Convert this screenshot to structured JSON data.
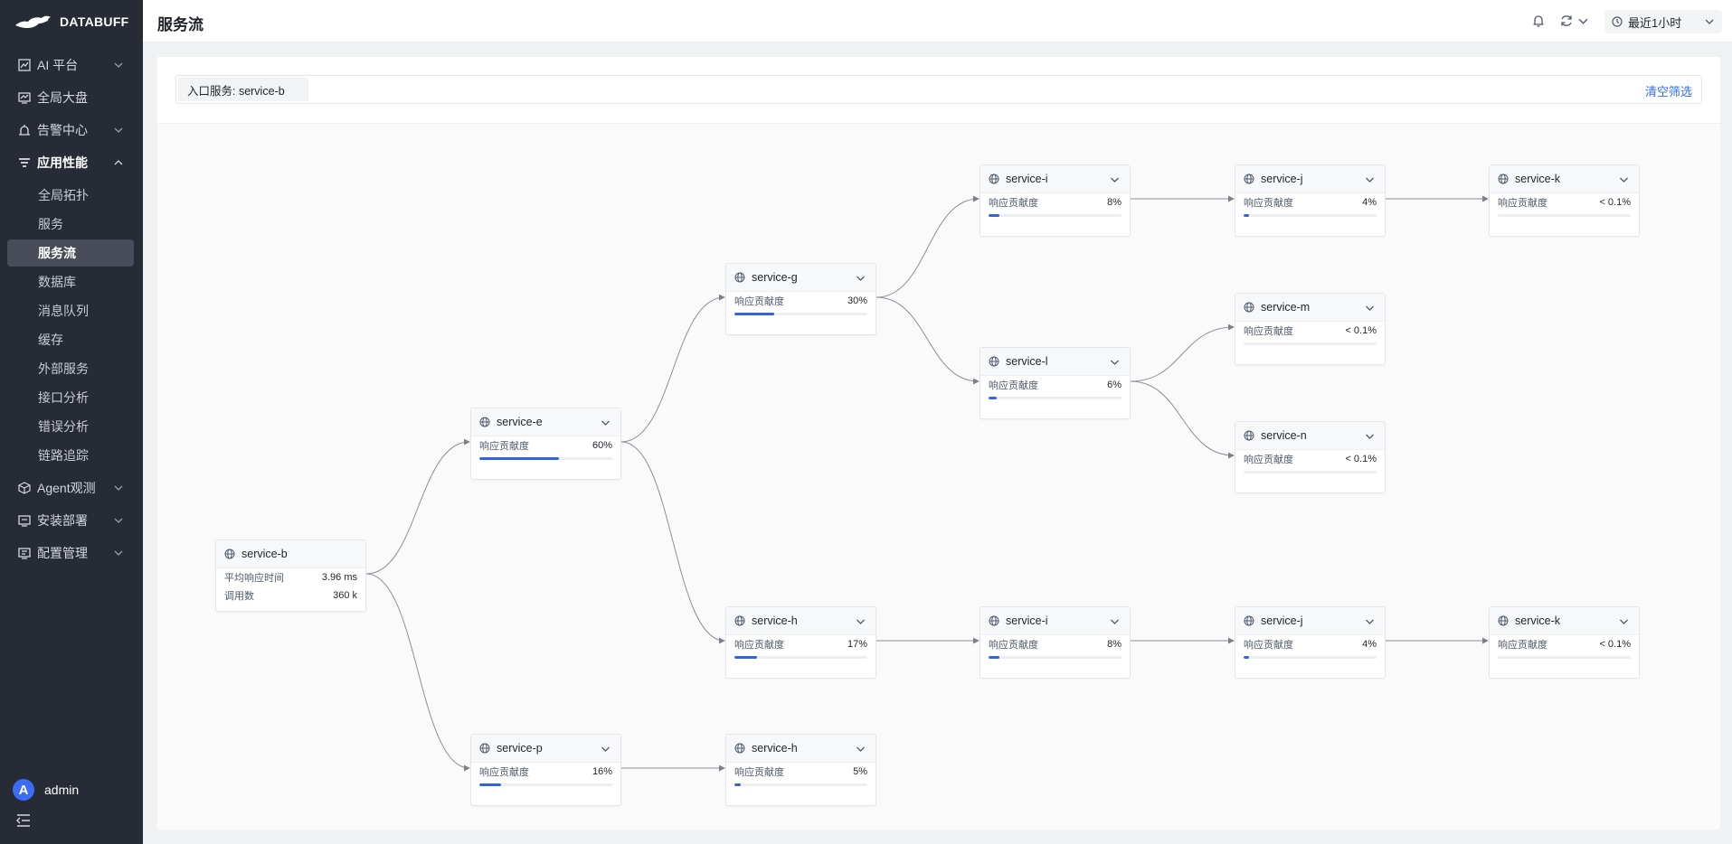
{
  "brand": {
    "name": "DATABUFF"
  },
  "nav": {
    "groups": [
      {
        "label": "AI 平台",
        "icon": "chart-icon"
      },
      {
        "label": "全局大盘",
        "icon": "dashboard-icon"
      },
      {
        "label": "告警中心",
        "icon": "alarm-icon"
      },
      {
        "label": "应用性能",
        "icon": "filter-icon",
        "open": true
      },
      {
        "label": "Agent观测",
        "icon": "cube-icon"
      },
      {
        "label": "安装部署",
        "icon": "deploy-icon"
      },
      {
        "label": "配置管理",
        "icon": "config-icon"
      }
    ],
    "sub_items": [
      "全局拓扑",
      "服务",
      "服务流",
      "数据库",
      "消息队列",
      "缓存",
      "外部服务",
      "接口分析",
      "错误分析",
      "链路追踪"
    ],
    "active_sub": "服务流"
  },
  "user": {
    "initial": "A",
    "name": "admin"
  },
  "header": {
    "title": "服务流",
    "time_range": "最近1小时"
  },
  "filter": {
    "tag": "入口服务: service-b",
    "clear_label": "清空筛选"
  },
  "metric_label": "响应贡献度",
  "root": {
    "name": "service-b",
    "metrics": [
      {
        "label": "平均响应时间",
        "value": "3.96 ms"
      },
      {
        "label": "调用数",
        "value": "360 k"
      }
    ]
  },
  "nodes": [
    {
      "id": "e",
      "name": "service-e",
      "value": "60%",
      "fraction": 0.6
    },
    {
      "id": "p",
      "name": "service-p",
      "value": "16%",
      "fraction": 0.16
    },
    {
      "id": "g",
      "name": "service-g",
      "value": "30%",
      "fraction": 0.3
    },
    {
      "id": "h1",
      "name": "service-h",
      "value": "17%",
      "fraction": 0.17
    },
    {
      "id": "h2",
      "name": "service-h",
      "value": "5%",
      "fraction": 0.05
    },
    {
      "id": "i1",
      "name": "service-i",
      "value": "8%",
      "fraction": 0.08
    },
    {
      "id": "l",
      "name": "service-l",
      "value": "6%",
      "fraction": 0.06
    },
    {
      "id": "i2",
      "name": "service-i",
      "value": "8%",
      "fraction": 0.08
    },
    {
      "id": "j1",
      "name": "service-j",
      "value": "4%",
      "fraction": 0.04
    },
    {
      "id": "m",
      "name": "service-m",
      "value": "< 0.1%",
      "fraction": 0
    },
    {
      "id": "n",
      "name": "service-n",
      "value": "< 0.1%",
      "fraction": 0
    },
    {
      "id": "j2",
      "name": "service-j",
      "value": "4%",
      "fraction": 0.04
    },
    {
      "id": "k1",
      "name": "service-k",
      "value": "< 0.1%",
      "fraction": 0
    },
    {
      "id": "k2",
      "name": "service-k",
      "value": "< 0.1%",
      "fraction": 0
    }
  ],
  "edges": [
    [
      "b",
      "e"
    ],
    [
      "b",
      "p"
    ],
    [
      "e",
      "g"
    ],
    [
      "e",
      "h1"
    ],
    [
      "p",
      "h2"
    ],
    [
      "g",
      "i1"
    ],
    [
      "g",
      "l"
    ],
    [
      "h1",
      "i2"
    ],
    [
      "i1",
      "j1"
    ],
    [
      "l",
      "m"
    ],
    [
      "l",
      "n"
    ],
    [
      "i2",
      "j2"
    ],
    [
      "j1",
      "k1"
    ],
    [
      "j2",
      "k2"
    ]
  ]
}
